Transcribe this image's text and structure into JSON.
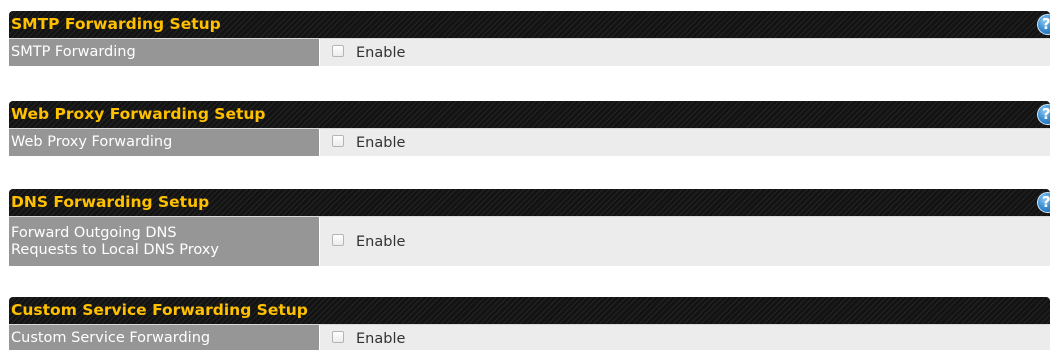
{
  "sections": [
    {
      "title": "SMTP Forwarding Setup",
      "help_icon": "?",
      "field_label": "SMTP Forwarding",
      "checkbox_label": "Enable",
      "checked": false
    },
    {
      "title": "Web Proxy Forwarding Setup",
      "help_icon": "?",
      "field_label": "Web Proxy Forwarding",
      "checkbox_label": "Enable",
      "checked": false
    },
    {
      "title": "DNS Forwarding Setup",
      "help_icon": "?",
      "field_label_lines": [
        "Forward Outgoing DNS",
        "Requests to Local DNS Proxy"
      ],
      "checkbox_label": "Enable",
      "checked": false
    },
    {
      "title": "Custom Service Forwarding Setup",
      "field_label": "Custom Service Forwarding",
      "checkbox_label": "Enable",
      "checked": false
    }
  ],
  "colors": {
    "header_bg": "#131313",
    "header_text": "#ffc000",
    "label_bg": "#969696",
    "value_bg": "#ececec",
    "help_icon": "#3d8fd4"
  }
}
